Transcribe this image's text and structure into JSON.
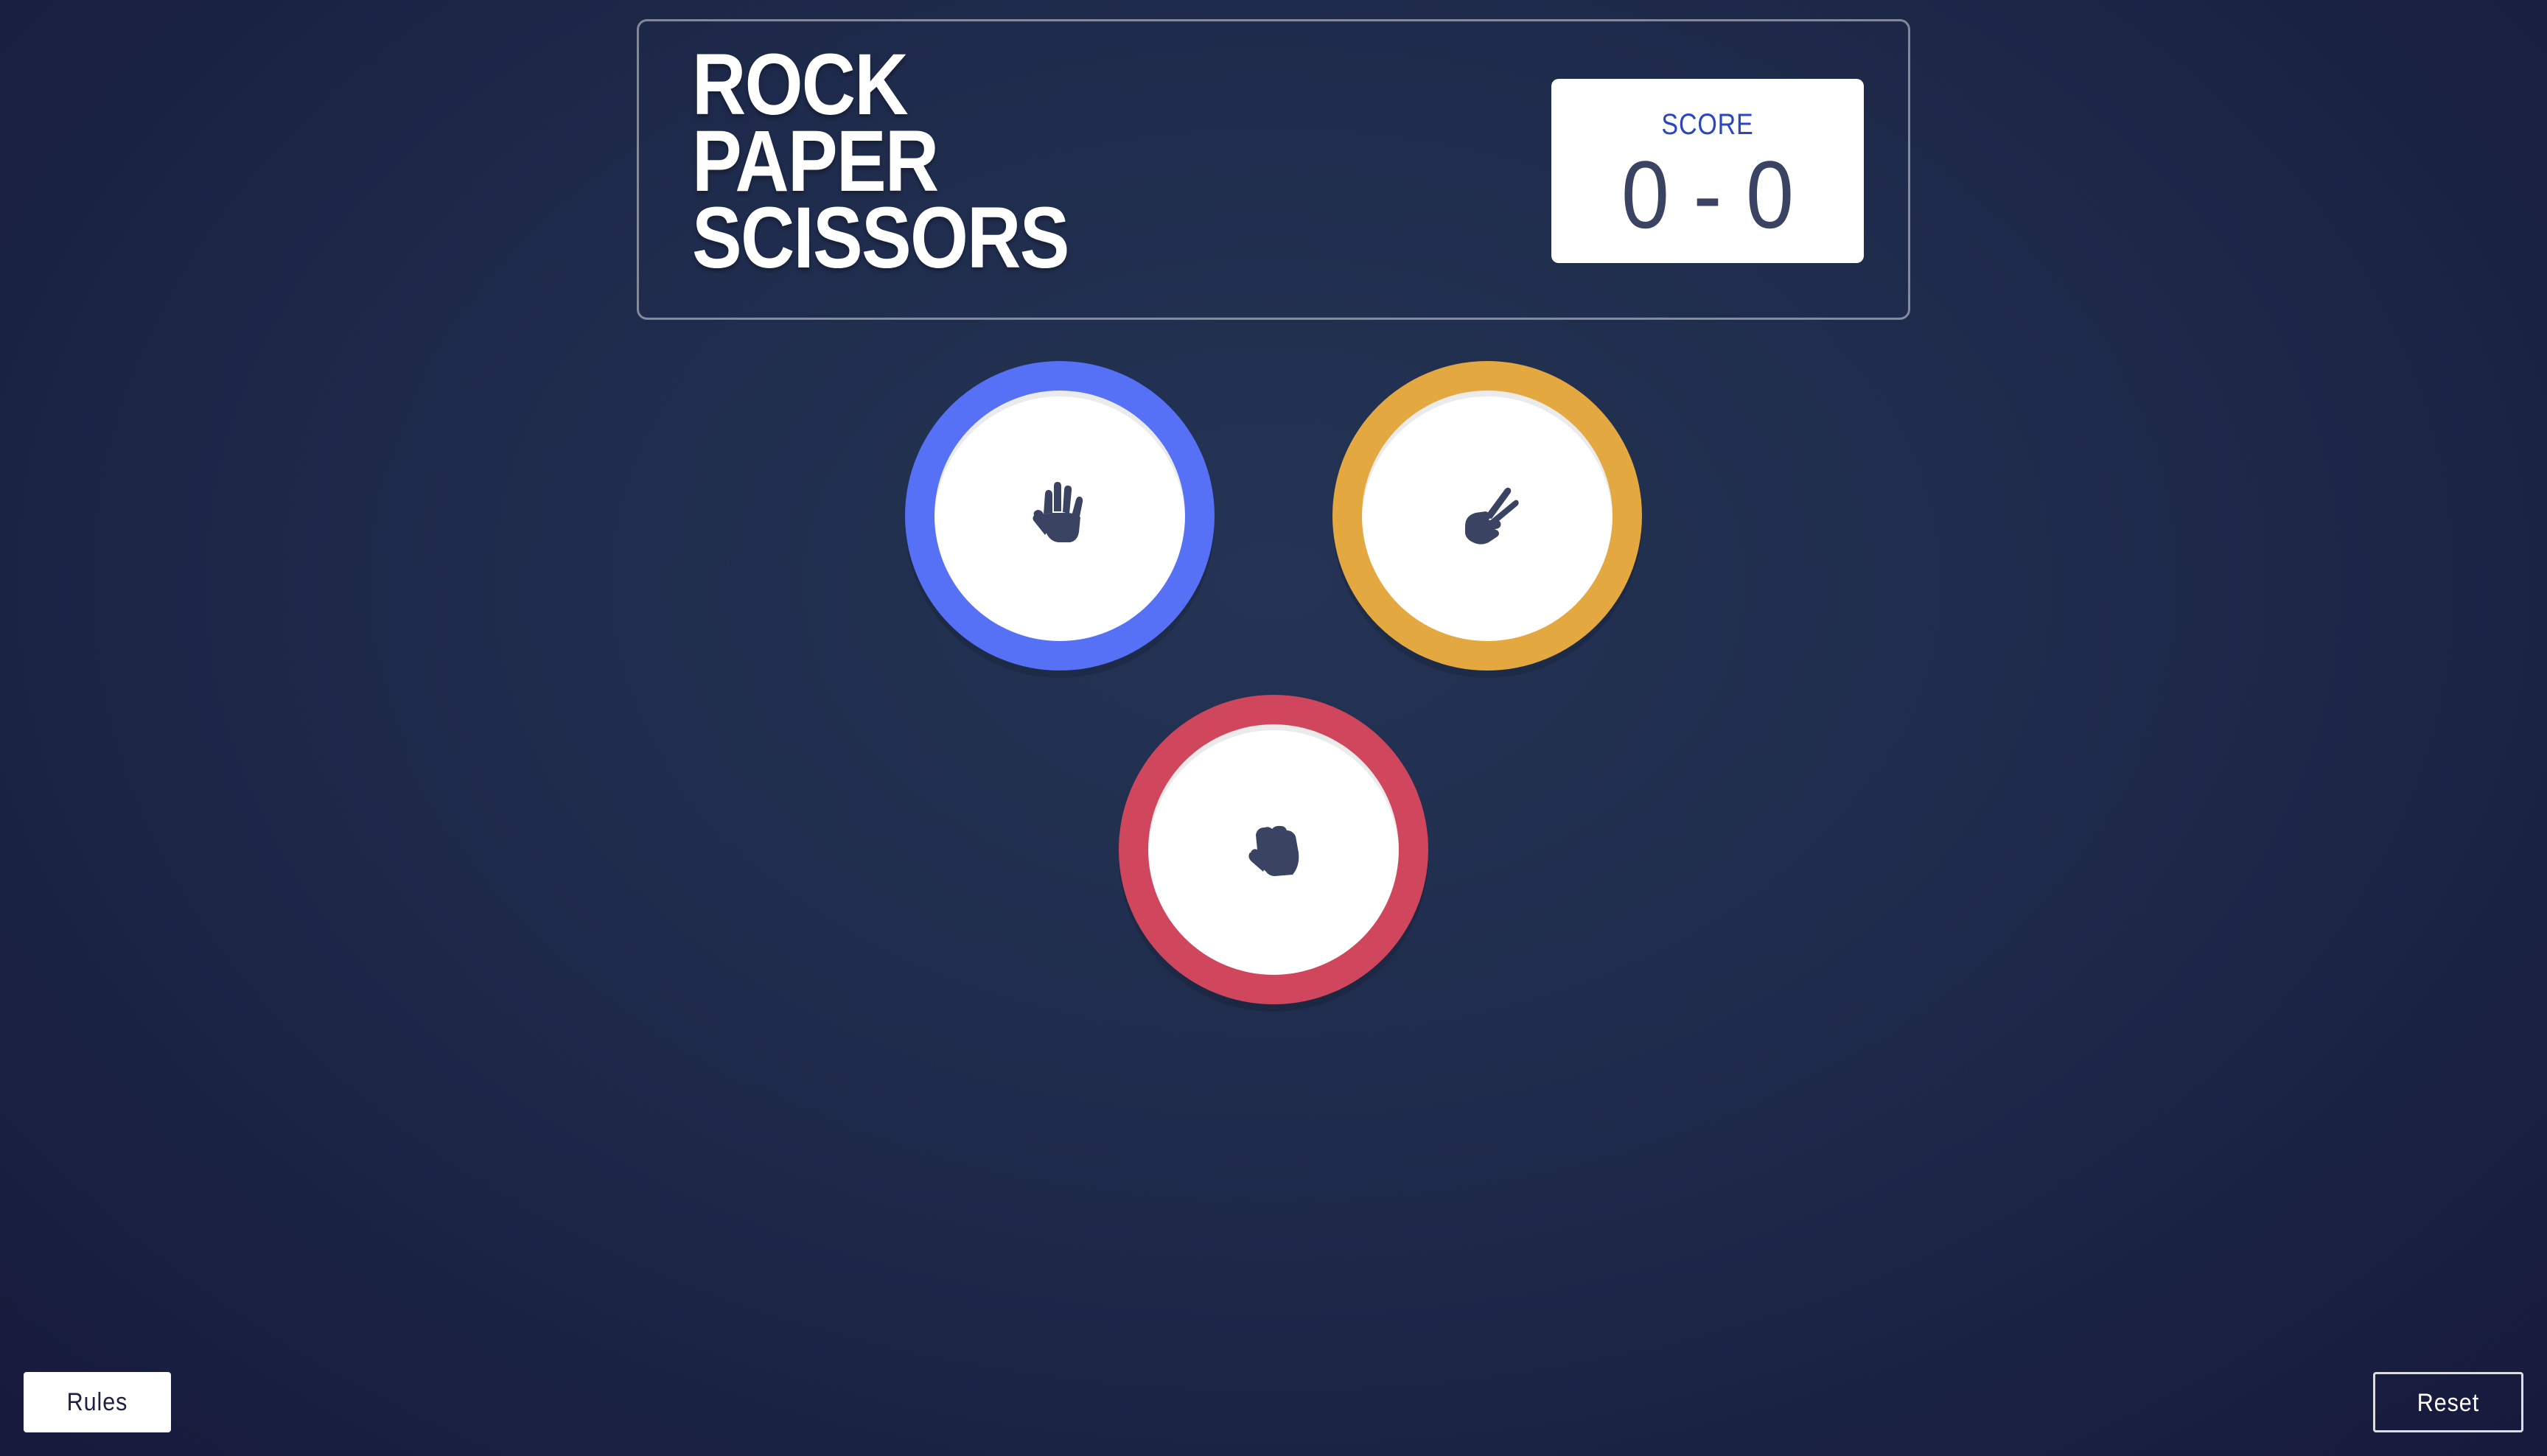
{
  "header": {
    "title_lines": [
      "ROCK",
      "PAPER",
      "SCISSORS"
    ],
    "score_label": "SCORE",
    "score_value": "0 - 0"
  },
  "tokens": [
    {
      "name": "paper",
      "ring_color": "#5671f5",
      "icon": "paper-hand-icon"
    },
    {
      "name": "scissors",
      "ring_color": "#e3a840",
      "icon": "scissors-hand-icon"
    },
    {
      "name": "rock",
      "ring_color": "#d0465d",
      "icon": "rock-fist-icon"
    }
  ],
  "footer": {
    "rules_label": "Rules",
    "reset_label": "Reset"
  },
  "colors": {
    "background": "#1f2b4c",
    "icon": "#3b4363",
    "score_label": "#2a46c0"
  }
}
